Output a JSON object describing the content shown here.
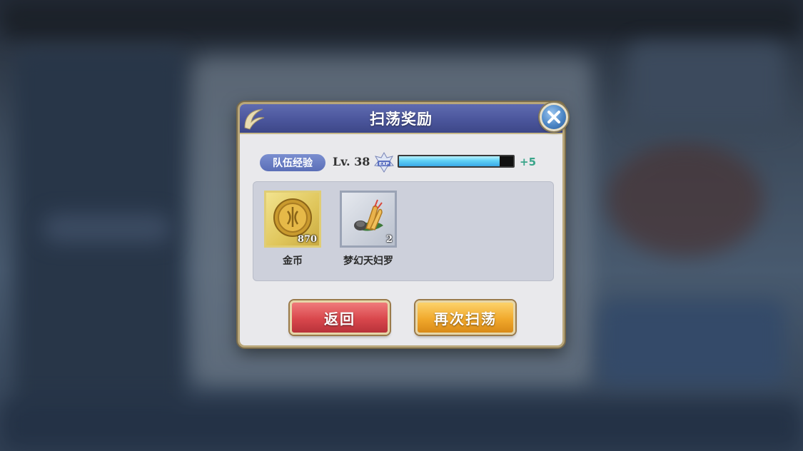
{
  "dialog": {
    "title": "扫荡奖励",
    "close_icon": "close-x-icon"
  },
  "exp": {
    "label": "队伍经验",
    "level": "Lv. 38",
    "badge_icon": "exp-badge-icon",
    "progress": 0.88,
    "gain": "+5"
  },
  "rewards": [
    {
      "name": "金币",
      "count": "870",
      "icon": "gold-coin-icon"
    },
    {
      "name": "梦幻天妇罗",
      "count": "2",
      "icon": "tempura-icon"
    }
  ],
  "buttons": {
    "back": "返回",
    "sweep_again": "再次扫荡"
  },
  "colors": {
    "title_bar": "#4b569c",
    "back_button": "#d9474c",
    "sweep_button": "#f1a92c",
    "exp_gain": "#3aa58a"
  }
}
